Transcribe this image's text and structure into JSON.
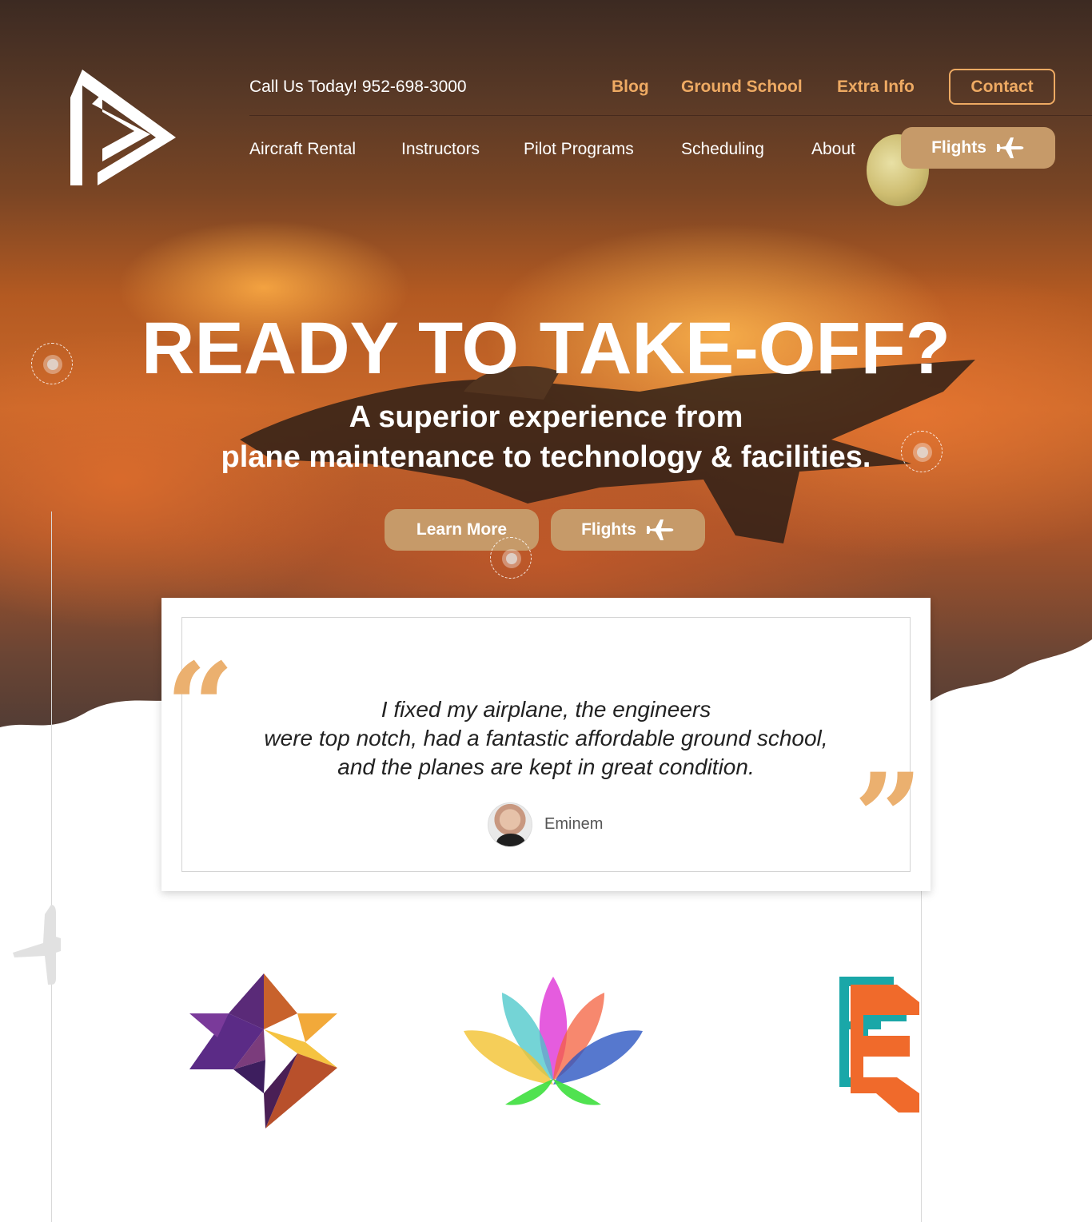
{
  "header": {
    "phone_text": "Call Us Today! 952-698-3000",
    "top_links": [
      "Blog",
      "Ground School",
      "Extra Info"
    ],
    "contact_label": "Contact",
    "main_nav": [
      "Aircraft Rental",
      "Instructors",
      "Pilot Programs",
      "Scheduling",
      "About"
    ],
    "flights_label": "Flights"
  },
  "hero": {
    "headline": "READY TO TAKE-OFF?",
    "sub_line1": "A superior experience from",
    "sub_line2": "plane maintenance to technology & facilities.",
    "learn_more_label": "Learn More",
    "flights_label": "Flights"
  },
  "testimonial": {
    "line1": "I fixed my airplane, the engineers",
    "line2": "were top notch, had a fantastic affordable ground school,",
    "line3": "and the planes are kept in great condition.",
    "author": "Eminem",
    "open_quote": "“",
    "close_quote": "”"
  },
  "colors": {
    "accent": "#eeaa63",
    "button": "#c69a69",
    "quote": "#ebb06f"
  },
  "icons": [
    "brand-logo-icon",
    "airplane-icon",
    "quote-icon",
    "star-logo-icon",
    "lotus-logo-icon",
    "e-logo-icon"
  ]
}
